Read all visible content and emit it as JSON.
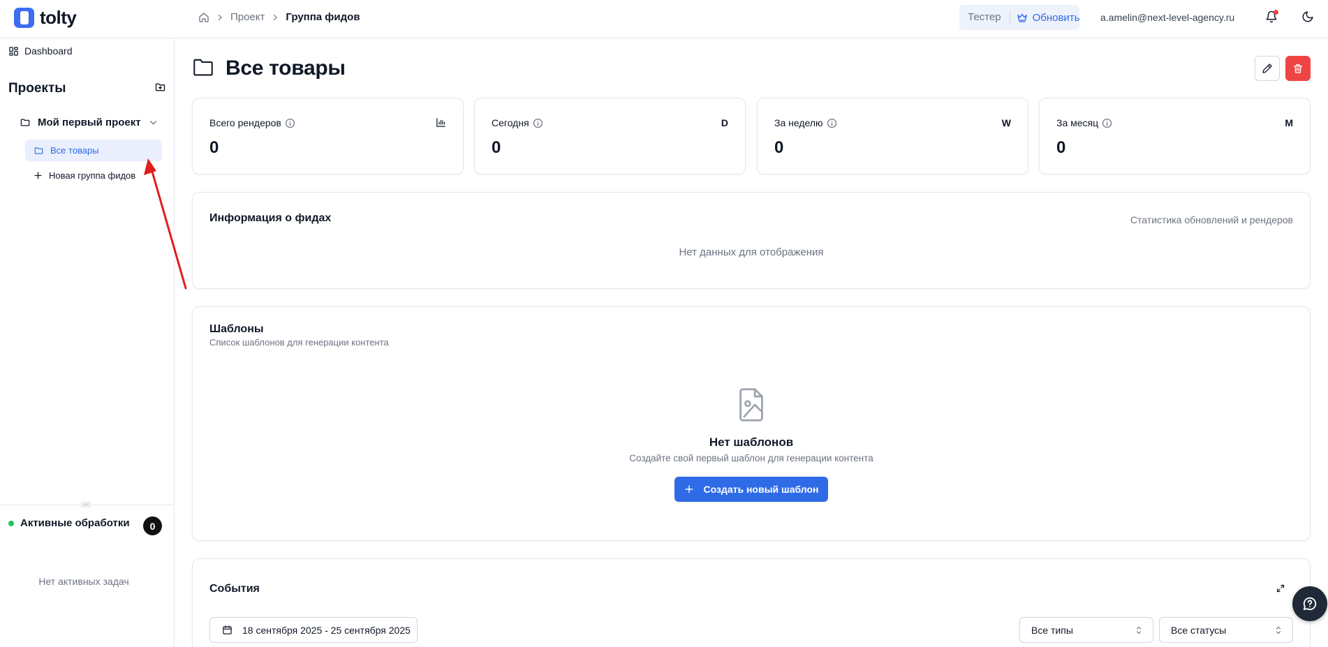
{
  "app": {
    "name": "tolty"
  },
  "breadcrumb": {
    "items": [
      "Проект",
      "Группа фидов"
    ]
  },
  "header": {
    "plan_label": "Тестер",
    "upgrade_label": "Обновить",
    "user_email": "a.amelin@next-level-agency.ru"
  },
  "sidebar": {
    "dashboard_label": "Dashboard",
    "projects_title": "Проекты",
    "project_name": "Мой первый проект",
    "groups": [
      {
        "label": "Все товары",
        "active": true
      }
    ],
    "new_group_label": "Новая группа фидов",
    "active_tasks_label": "Активные обработки",
    "active_tasks_count": "0",
    "no_tasks_label": "Нет активных задач"
  },
  "page": {
    "title": "Все товары"
  },
  "stats": [
    {
      "label": "Всего рендеров",
      "badge": "",
      "value": "0"
    },
    {
      "label": "Сегодня",
      "badge": "D",
      "value": "0"
    },
    {
      "label": "За неделю",
      "badge": "W",
      "value": "0"
    },
    {
      "label": "За месяц",
      "badge": "M",
      "value": "0"
    }
  ],
  "feeds_info": {
    "title": "Информация о фидах",
    "subtitle": "Статистика обновлений и рендеров",
    "empty": "Нет данных для отображения"
  },
  "templates": {
    "title": "Шаблоны",
    "description": "Список шаблонов для генерации контента",
    "empty_title": "Нет шаблонов",
    "empty_description": "Создайте свой первый шаблон для генерации контента",
    "create_label": "Создать новый шаблон"
  },
  "events": {
    "title": "События",
    "date_range": "18 сентября 2025 - 25 сентября 2025",
    "type_filter": "Все типы",
    "status_filter": "Все статусы"
  },
  "colors": {
    "accent": "#2f6be6",
    "danger": "#ef4444",
    "active_dot": "#22c55e",
    "annotation": "#e11d1d"
  }
}
